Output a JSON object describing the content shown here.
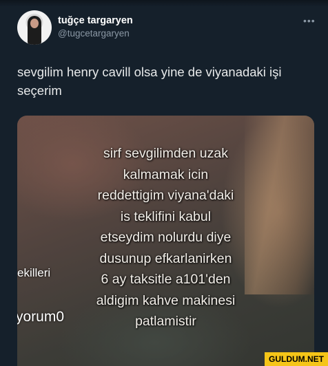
{
  "author": {
    "display_name": "tuğçe targaryen",
    "handle": "@tugcetargaryen",
    "more_icon": "more-horizontal-icon"
  },
  "tweet": {
    "text": "sevgilim henry cavill olsa yine de viyanadaki işi seçerim"
  },
  "media": {
    "overlay_lines": [
      "sirf sevgilimden uzak",
      "kalmamak icin",
      "reddettigim viyana'daki",
      "is teklifini kabul",
      "etseydim nolurdu diye",
      "dusunup efkarlanirken",
      "6 ay taksitle a101'den",
      "aldigim kahve makinesi",
      "patlamistir"
    ],
    "side_text_a": "ekilleri",
    "side_text_b": "yorum0"
  },
  "watermark": "GULDUM.NET"
}
